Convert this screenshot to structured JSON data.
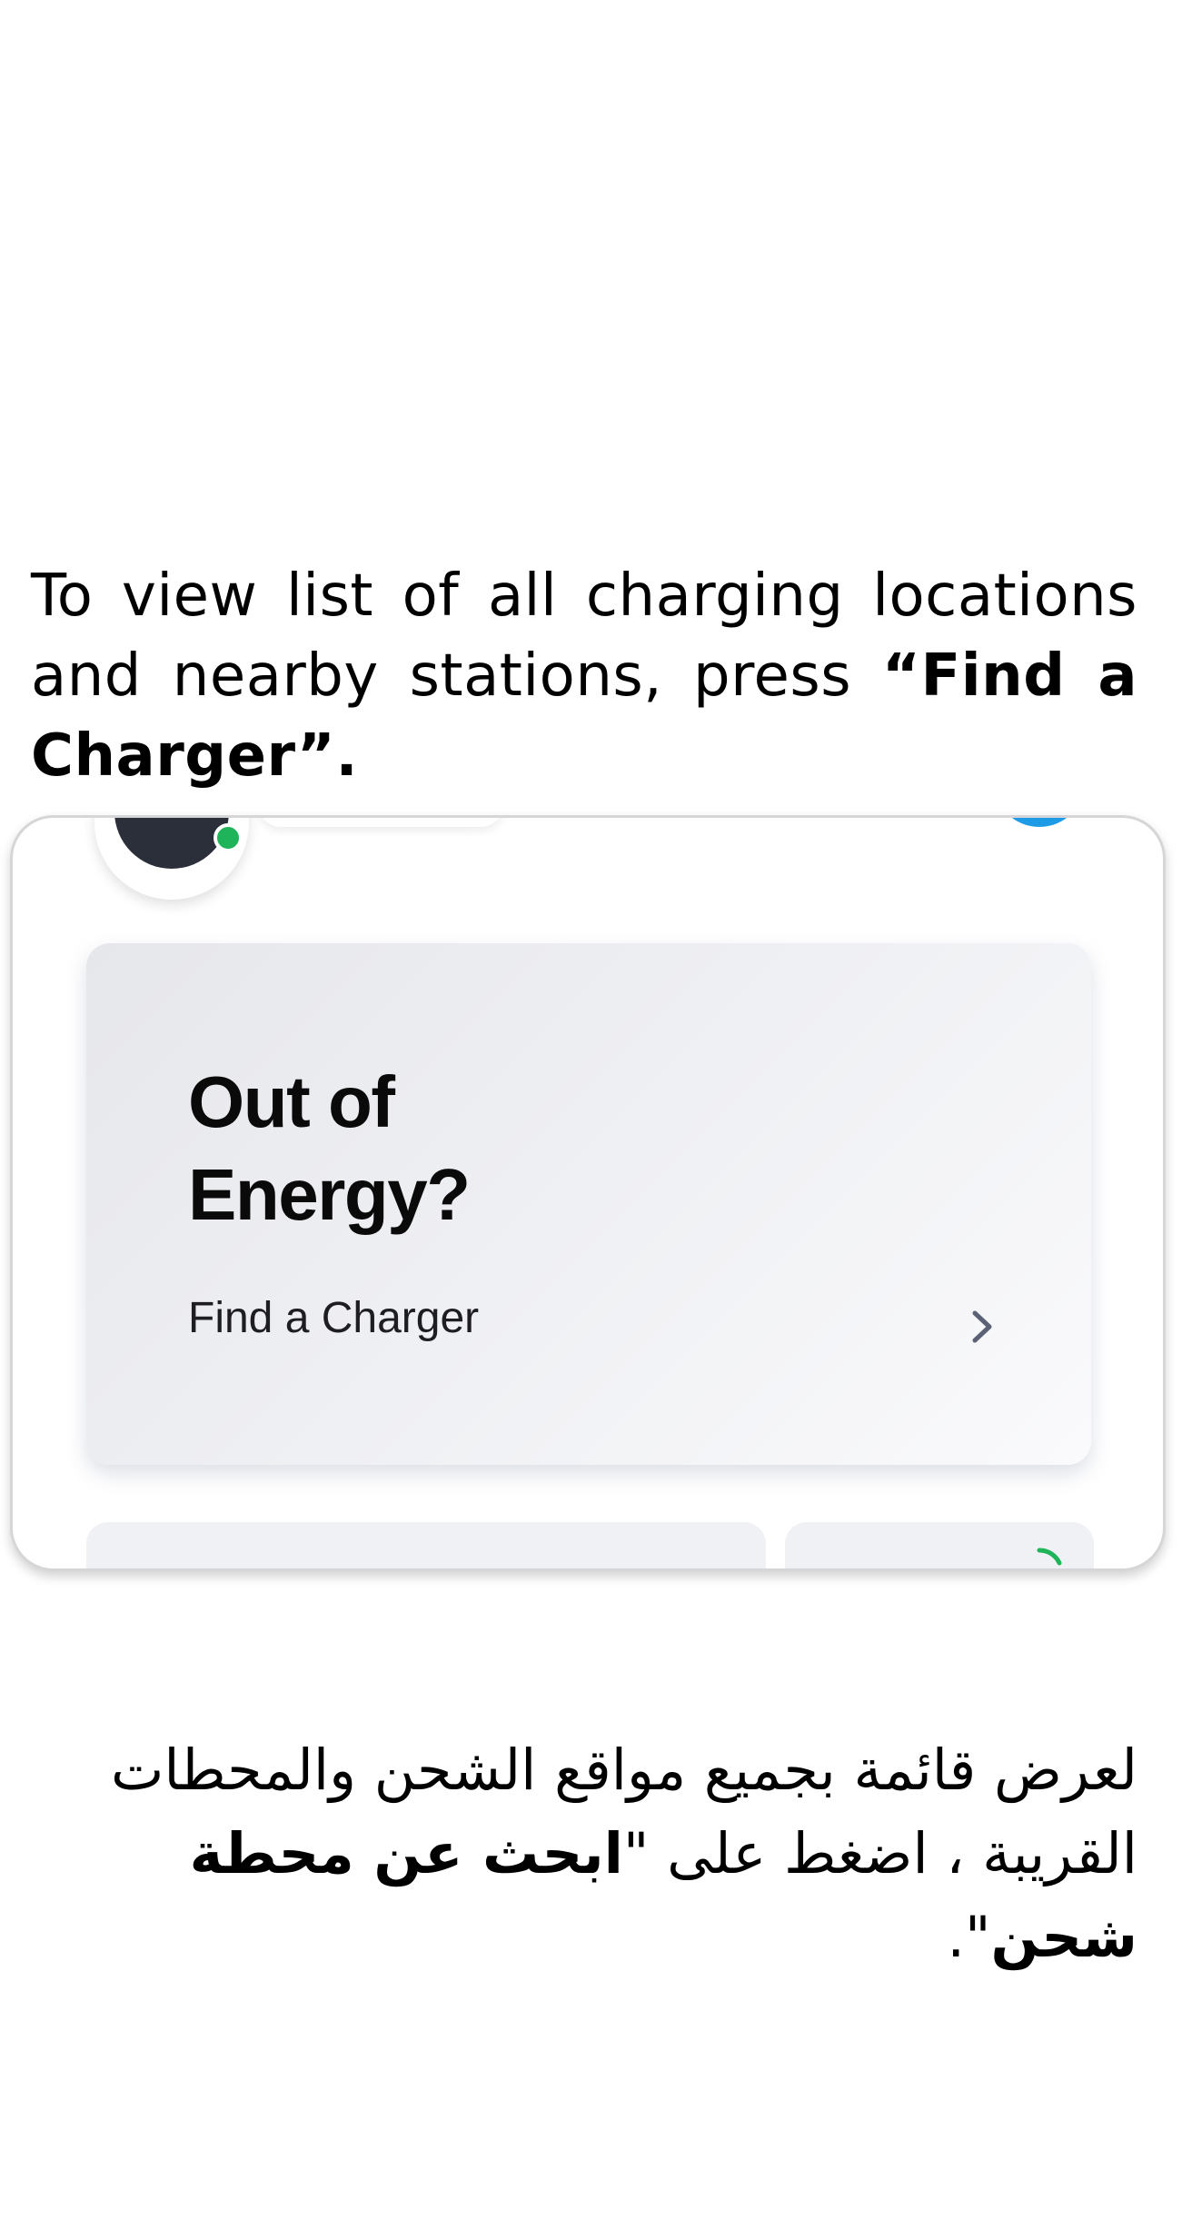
{
  "instruction_en": {
    "text": "To view list of all charging locations and nearby stations, press ",
    "highlight": "“Find a Charger”."
  },
  "screen": {
    "energy_card": {
      "title": "Out of Energy?",
      "link_label": "Find a Charger",
      "chevron_icon": "chevron-right-icon"
    },
    "header": {
      "avatar_icon": "user-avatar",
      "status_color": "#1fb35a",
      "action_color": "#1e9be6"
    }
  },
  "instruction_ar": {
    "text": "لعرض قائمة بجميع مواقع الشحن والمحطات القريبة ، اضغط على \"",
    "highlight": "ابحث عن محطة شحن",
    "tail": "\"."
  }
}
